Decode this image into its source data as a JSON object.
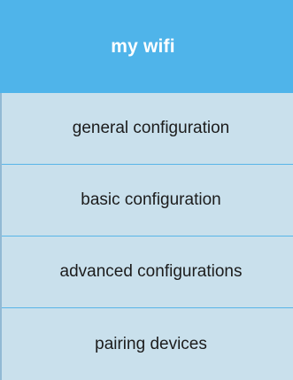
{
  "header": {
    "title": "my wifi"
  },
  "menu": {
    "items": [
      {
        "label": "general configuration"
      },
      {
        "label": "basic configuration"
      },
      {
        "label": "advanced configurations"
      },
      {
        "label": "pairing devices"
      }
    ]
  },
  "colors": {
    "header_background": "#4fb4ea",
    "item_background": "#c9e0ec",
    "divider": "#58b5e8",
    "text": "#1c1c1c",
    "header_text": "#ffffff"
  }
}
